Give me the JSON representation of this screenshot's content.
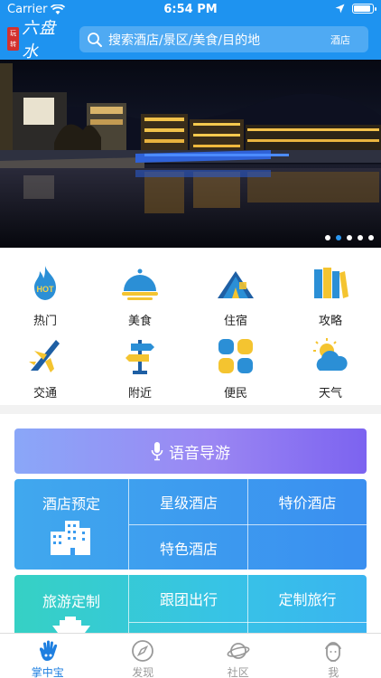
{
  "status_bar": {
    "carrier": "Carrier",
    "time": "6:54 PM",
    "battery_level": 0.95
  },
  "header": {
    "logo_seal": "玩转",
    "logo_text": "六盘水",
    "search_placeholder": "搜索酒店/景区/美食/目的地",
    "search_tag": "酒店"
  },
  "banner": {
    "slide_count": 5,
    "active_slide": 2
  },
  "quick_nav": [
    {
      "label": "热门",
      "icon": "hot-flame-icon",
      "badge": "HOT"
    },
    {
      "label": "美食",
      "icon": "food-cloche-icon"
    },
    {
      "label": "住宿",
      "icon": "tent-icon"
    },
    {
      "label": "攻略",
      "icon": "books-icon"
    },
    {
      "label": "交通",
      "icon": "airplane-icon"
    },
    {
      "label": "附近",
      "icon": "signpost-icon"
    },
    {
      "label": "便民",
      "icon": "grid-tiles-icon"
    },
    {
      "label": "天气",
      "icon": "weather-cloud-icon"
    }
  ],
  "voice_guide": {
    "label": "语音导游",
    "icon": "microphone-icon"
  },
  "hotel": {
    "main_label": "酒店预定",
    "items": [
      "星级酒店",
      "特价酒店",
      "特色酒店"
    ],
    "icon": "buildings-icon"
  },
  "travel": {
    "main_label": "旅游定制",
    "items": [
      "跟团出行",
      "定制旅行"
    ],
    "icon": "cruise-ship-icon"
  },
  "tabbar": [
    {
      "label": "掌中宝",
      "icon": "hand-icon",
      "active": true
    },
    {
      "label": "发现",
      "icon": "compass-icon",
      "active": false
    },
    {
      "label": "社区",
      "icon": "planet-icon",
      "active": false
    },
    {
      "label": "我",
      "icon": "profile-face-icon",
      "active": false
    }
  ],
  "colors": {
    "header": "#1e93f0",
    "accent": "#1e7fe0",
    "hotel_block": "#3a8ff0",
    "travel_block": "#37c3e6",
    "voice_block": "#9b87f3"
  }
}
